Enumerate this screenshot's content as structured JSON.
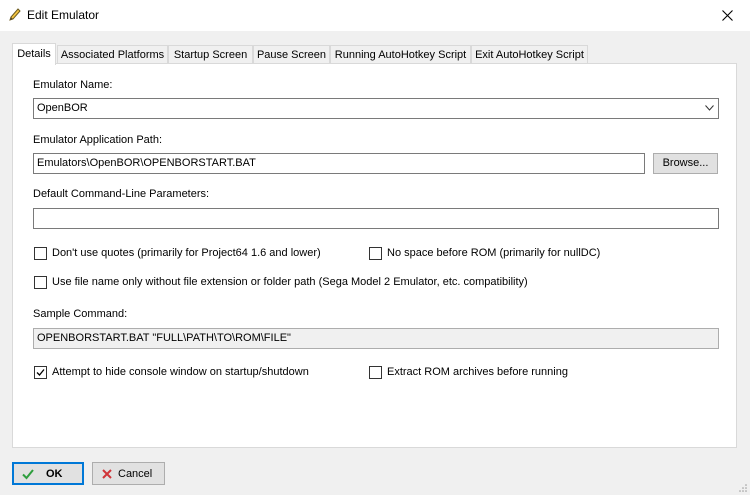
{
  "window": {
    "title": "Edit Emulator"
  },
  "tabs": [
    {
      "label": "Details"
    },
    {
      "label": "Associated Platforms"
    },
    {
      "label": "Startup Screen"
    },
    {
      "label": "Pause Screen"
    },
    {
      "label": "Running AutoHotkey Script"
    },
    {
      "label": "Exit AutoHotkey Script"
    }
  ],
  "details": {
    "emulator_name_label": "Emulator Name:",
    "emulator_name_value": "OpenBOR",
    "app_path_label": "Emulator Application Path:",
    "app_path_value": "Emulators\\OpenBOR\\OPENBORSTART.BAT",
    "browse_label": "Browse...",
    "params_label": "Default Command-Line Parameters:",
    "params_value": "",
    "options": {
      "no_quotes": {
        "label": "Don't use quotes (primarily for Project64 1.6 and lower)",
        "checked": false
      },
      "no_space": {
        "label": "No space before ROM (primarily for nullDC)",
        "checked": false
      },
      "file_name_only": {
        "label": "Use file name only without file extension or folder path (Sega Model 2 Emulator, etc. compatibility)",
        "checked": false
      },
      "hide_console": {
        "label": "Attempt to hide console window on startup/shutdown",
        "checked": true
      },
      "extract_rom": {
        "label": "Extract ROM archives before running",
        "checked": false
      }
    },
    "sample_label": "Sample Command:",
    "sample_value": "OPENBORSTART.BAT \"FULL\\PATH\\TO\\ROM\\FILE\""
  },
  "footer": {
    "ok_label": "OK",
    "cancel_label": "Cancel"
  },
  "colors": {
    "accent": "#0078d7",
    "ok_check": "#2e9e3e",
    "cancel_x": "#d13438"
  }
}
